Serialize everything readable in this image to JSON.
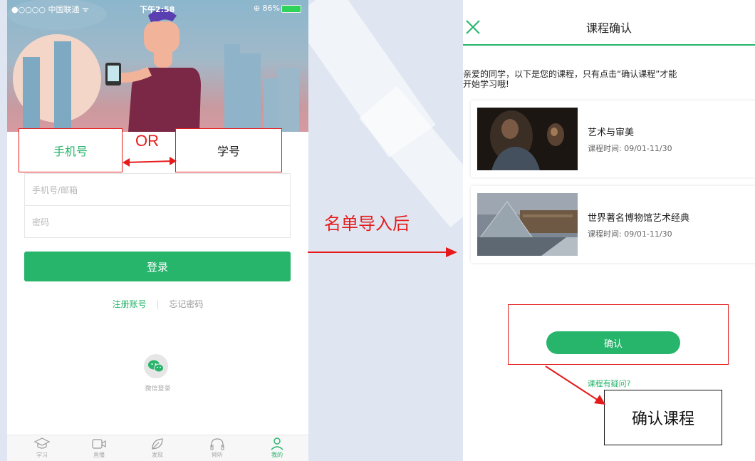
{
  "left_screen": {
    "status": {
      "carrier": "●○○○○ 中国联通 ᯤ",
      "time": "下午2:58",
      "battery": "⊕ 86%"
    },
    "tabs": {
      "phone_tab": "手机号",
      "student_id_tab": "学号"
    },
    "or_label": "OR",
    "fields": {
      "account_placeholder": "手机号/邮箱",
      "password_placeholder": "密码"
    },
    "login_button": "登录",
    "register_link": "注册账号",
    "forgot_link": "忘记密码",
    "wechat_login": "微信登录",
    "nav": [
      {
        "label": "学习",
        "icon": "graduation-cap-icon"
      },
      {
        "label": "直播",
        "icon": "video-icon"
      },
      {
        "label": "发现",
        "icon": "leaf-icon"
      },
      {
        "label": "倾听",
        "icon": "headphones-icon"
      },
      {
        "label": "我的",
        "icon": "person-icon"
      }
    ],
    "accent_color": "#27b46b"
  },
  "transition_label": "名单导入后",
  "right_screen": {
    "title": "课程确认",
    "intro_line1": "亲爱的同学，以下是您的课程，只有点击“确认课程”才能",
    "intro_line2": "开始学习哦!",
    "courses": [
      {
        "name": "艺术与审美",
        "time": "课程时间: 09/01-11/30"
      },
      {
        "name": "世界著名博物馆艺术经典",
        "time": "课程时间: 09/01-11/30"
      }
    ],
    "confirm_button": "确认",
    "question_link": "课程有疑问?",
    "callout_label": "确认课程"
  },
  "annotation_color": "#e51b1b"
}
